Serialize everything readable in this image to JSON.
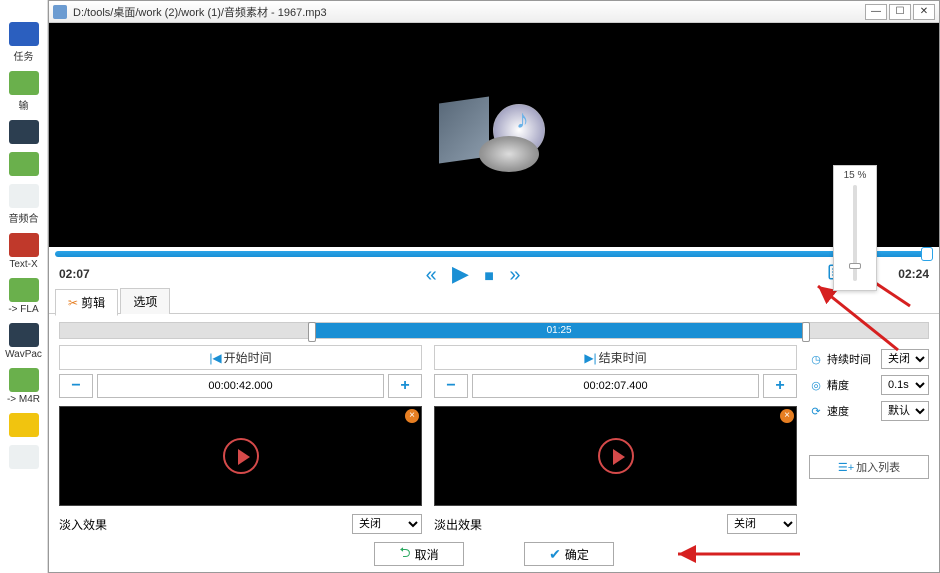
{
  "bg": {
    "labels": [
      "任务",
      "输",
      "",
      "音频合",
      "Text-X",
      "-> FLA",
      "WavPac",
      "-> M4R"
    ]
  },
  "titlebar": {
    "path": "D:/tools/桌面/work (2)/work (1)/音频素材 - 1967.mp3"
  },
  "volume": {
    "percent_label": "15 %"
  },
  "transport": {
    "current": "02:07",
    "total": "02:24"
  },
  "tabs": {
    "edit": "剪辑",
    "options": "选项"
  },
  "range": {
    "center_label": "01:25"
  },
  "start": {
    "header": "开始时间",
    "time": "00:00:42.000",
    "fade_label": "淡入效果",
    "fade_value": "关闭"
  },
  "end": {
    "header": "结束时间",
    "time": "00:02:07.400",
    "fade_label": "淡出效果",
    "fade_value": "关闭"
  },
  "settings": {
    "duration": {
      "label": "持续时间",
      "value": "关闭"
    },
    "precision": {
      "label": "精度",
      "value": "0.1s"
    },
    "speed": {
      "label": "速度",
      "value": "默认"
    },
    "add_list": "加入列表"
  },
  "buttons": {
    "cancel": "取消",
    "ok": "确定"
  }
}
